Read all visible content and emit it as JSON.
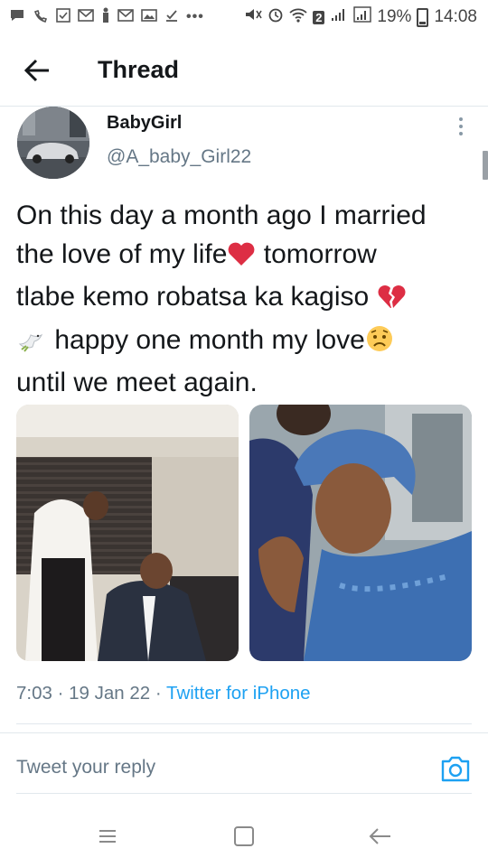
{
  "status_bar": {
    "battery": "19%",
    "time": "14:08",
    "sim_slot": "2"
  },
  "header": {
    "title": "Thread"
  },
  "tweet": {
    "display_name": "BabyGirl",
    "handle": "@A_baby_Girl22",
    "text_line1": "On this day a month ago I married",
    "text_line2a": "the love of my life",
    "text_line2b": " tomorrow",
    "text_line3": "tlabe kemo robatsa ka kagiso ",
    "text_line4": " happy one month my love",
    "text_line5": "until we meet again.",
    "time": "7:03",
    "sep1": " · ",
    "date": "19 Jan 22",
    "sep2": " · ",
    "source": "Twitter for iPhone"
  },
  "reply": {
    "placeholder": "Tweet your reply"
  },
  "icons": {
    "back": "arrow-left-icon",
    "more": "more-vertical-icon",
    "camera": "camera-icon",
    "heart_emoji": "red-heart-emoji",
    "broken_heart_emoji": "broken-heart-emoji",
    "dove_emoji": "dove-emoji",
    "worried_emoji": "worried-face-emoji"
  },
  "colors": {
    "accent": "#1da1f2",
    "text_primary": "#14171a",
    "text_secondary": "#657786",
    "divider": "#e1e8ed"
  }
}
